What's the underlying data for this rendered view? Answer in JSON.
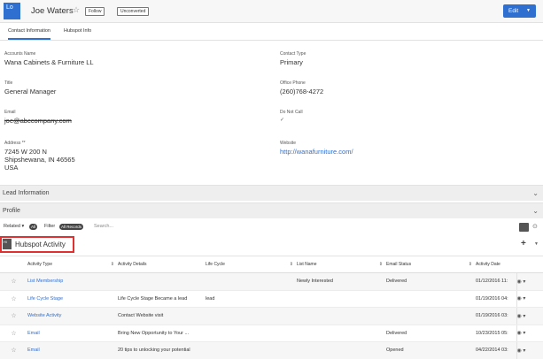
{
  "header": {
    "avatar_text": "Lo",
    "name": "Joe Waters",
    "follow_label": "Follow",
    "unconverted_label": "Unconverted",
    "edit_label": "Edit"
  },
  "tabs": [
    {
      "label": "Contact Information",
      "active": true
    },
    {
      "label": "Hubspot Info",
      "active": false
    }
  ],
  "fields": {
    "accounts_name": {
      "label": "Accounts Name",
      "value": "Wana Cabinets & Furniture LL"
    },
    "contact_type": {
      "label": "Contact Type",
      "value": "Primary"
    },
    "title": {
      "label": "Title",
      "value": "General Manager"
    },
    "office_phone": {
      "label": "Office Phone",
      "value": "(260)768-4272"
    },
    "email": {
      "label": "Email",
      "value": "joe@abccompany.com"
    },
    "do_not_call": {
      "label": "Do Not Call",
      "value": "✓"
    },
    "address": {
      "label": "Address **",
      "line1": "7245 W 200 N",
      "line2": "Shipshewana, IN  46565",
      "line3": "USA"
    },
    "website": {
      "label": "Website",
      "value": "http://wanafurniture.com/"
    }
  },
  "sections": {
    "lead_information": "Lead Information",
    "profile": "Profile"
  },
  "related_bar": {
    "related_label": "Related",
    "all_label": "All",
    "filter_label": "Filter",
    "all_records_label": "All Records",
    "search_placeholder": "Search..."
  },
  "subpanel": {
    "icon_text": "Hi",
    "title": "Hubspot Activity"
  },
  "table": {
    "columns": [
      "Activity Type",
      "Activity Details",
      "Life Cycle",
      "List Name",
      "Email Status",
      "Activity Date"
    ],
    "rows": [
      [
        "List Membership",
        "",
        "",
        "Newly Interested",
        "Delivered",
        "01/12/2016 11:"
      ],
      [
        "Life Cycle Stage",
        "Life Cycle Stage Became a lead",
        "lead",
        "",
        "",
        "01/19/2016 04:"
      ],
      [
        "Website Activity",
        "Contact Website visit",
        "",
        "",
        "",
        "01/19/2016 03:"
      ],
      [
        "Email",
        "Bring New Opportunity to Your ...",
        "",
        "",
        "Delivered",
        "10/23/2015 05:"
      ],
      [
        "Email",
        "20 tips to unlocking your potential",
        "",
        "",
        "Opened",
        "04/22/2014 03:"
      ]
    ]
  },
  "colors": {
    "accent": "#2f6fd0",
    "highlight_border": "#e03030"
  },
  "icons": {
    "favorite": "star-icon",
    "row_preview": "eye-icon",
    "collapse": "chevron-down-icon"
  }
}
